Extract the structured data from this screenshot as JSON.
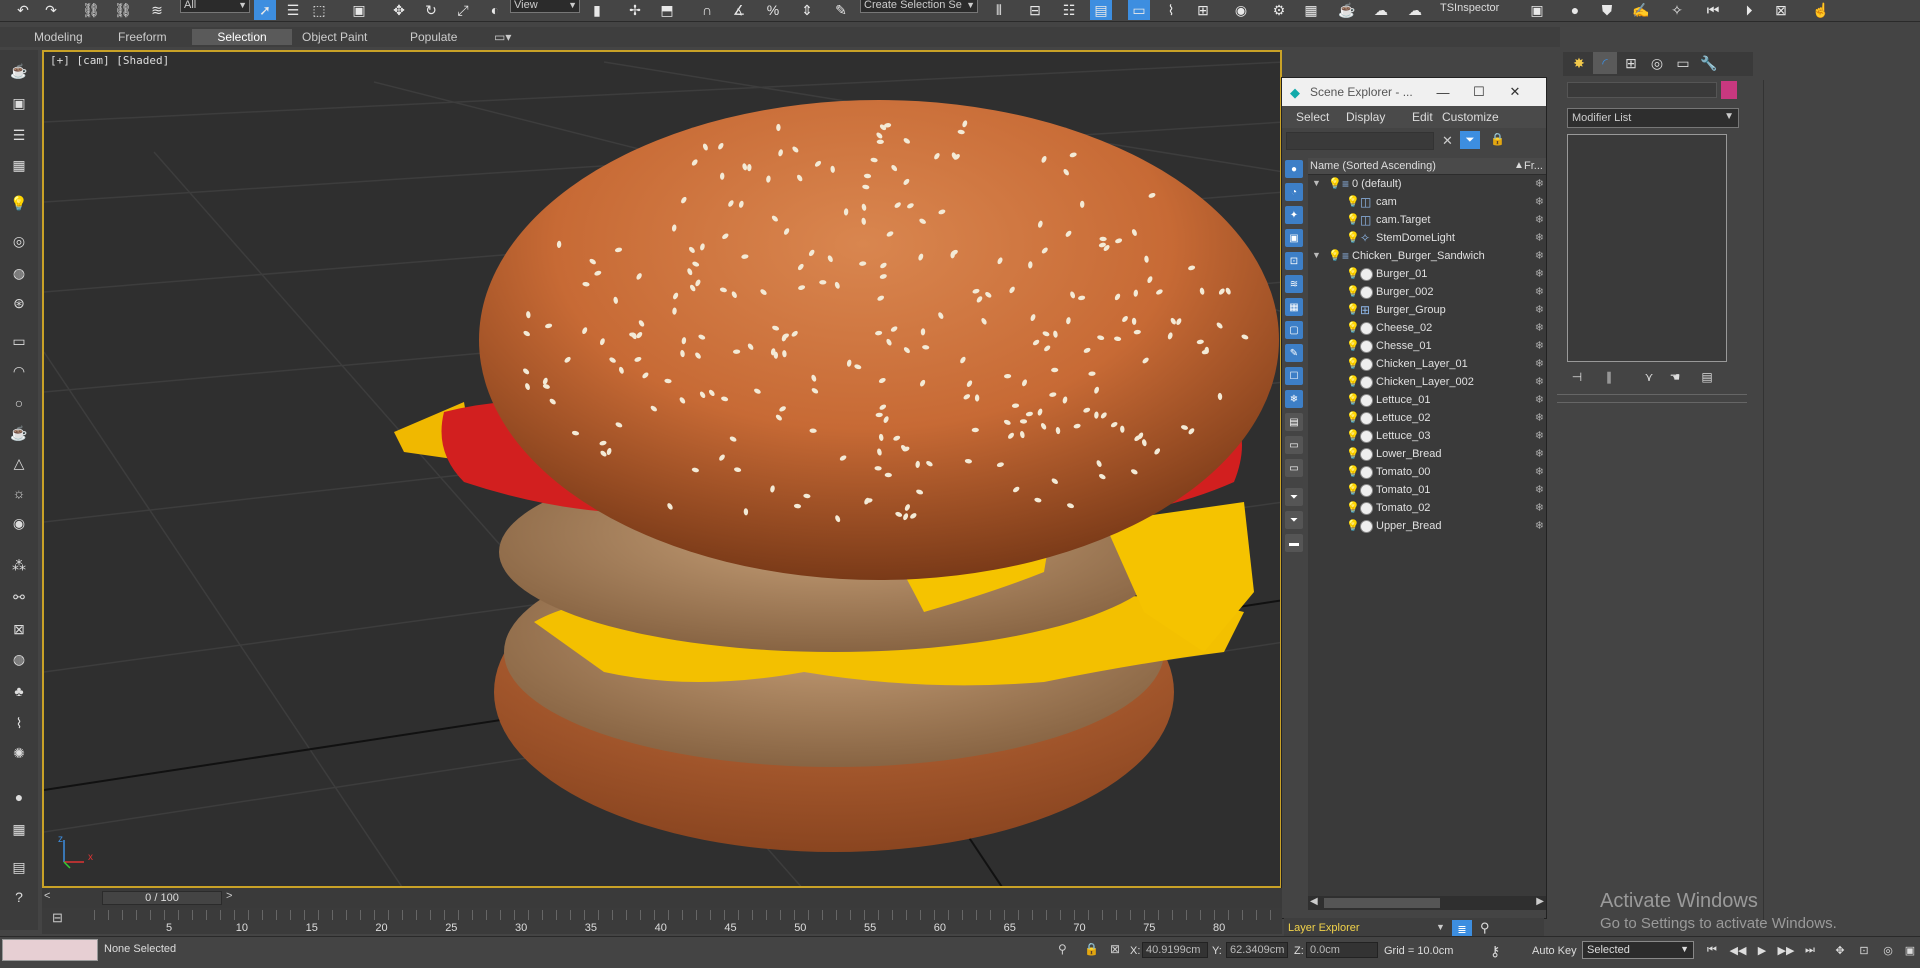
{
  "toolbar": {
    "filter_combo": "All",
    "refcoord_combo": "View",
    "selection_set_combo": "Create Selection Se",
    "plugin_label": "TSInspector"
  },
  "ribbon": {
    "tabs": [
      "Modeling",
      "Freeform",
      "Selection",
      "Object Paint",
      "Populate"
    ],
    "active_tab": "Selection"
  },
  "viewport": {
    "label": "[+] [cam] [Shaded]",
    "axis_x": "x",
    "axis_z": "z"
  },
  "scene_explorer": {
    "title": "Scene Explorer - ...",
    "menu": [
      "Select",
      "Display",
      "Edit",
      "Customize"
    ],
    "column_name": "Name (Sorted Ascending)",
    "column_frozen": "Fr...",
    "rows": [
      {
        "name": "0 (default)",
        "level": 0,
        "type": "layer"
      },
      {
        "name": "cam",
        "level": 1,
        "type": "camera"
      },
      {
        "name": "cam.Target",
        "level": 1,
        "type": "camera"
      },
      {
        "name": "StemDomeLight",
        "level": 1,
        "type": "light"
      },
      {
        "name": "Chicken_Burger_Sandwich",
        "level": 0,
        "type": "layer"
      },
      {
        "name": "Burger_01",
        "level": 1,
        "type": "geo"
      },
      {
        "name": "Burger_002",
        "level": 1,
        "type": "geo"
      },
      {
        "name": "Burger_Group",
        "level": 1,
        "type": "group"
      },
      {
        "name": "Cheese_02",
        "level": 1,
        "type": "geo"
      },
      {
        "name": "Chesse_01",
        "level": 1,
        "type": "geo"
      },
      {
        "name": "Chicken_Layer_01",
        "level": 1,
        "type": "geo"
      },
      {
        "name": "Chicken_Layer_002",
        "level": 1,
        "type": "geo"
      },
      {
        "name": "Lettuce_01",
        "level": 1,
        "type": "geo"
      },
      {
        "name": "Lettuce_02",
        "level": 1,
        "type": "geo"
      },
      {
        "name": "Lettuce_03",
        "level": 1,
        "type": "geo"
      },
      {
        "name": "Lower_Bread",
        "level": 1,
        "type": "geo"
      },
      {
        "name": "Tomato_00",
        "level": 1,
        "type": "geo"
      },
      {
        "name": "Tomato_01",
        "level": 1,
        "type": "geo"
      },
      {
        "name": "Tomato_02",
        "level": 1,
        "type": "geo"
      },
      {
        "name": "Upper_Bread",
        "level": 1,
        "type": "geo"
      }
    ],
    "layer_explorer_label": "Layer Explorer"
  },
  "command_panel": {
    "modifier_list": "Modifier List"
  },
  "activate_windows": {
    "line1": "Activate Windows",
    "line2": "Go to Settings to activate Windows."
  },
  "timeline": {
    "frame_display": "0 / 100",
    "ticks": [
      "5",
      "10",
      "15",
      "20",
      "25",
      "30",
      "35",
      "40",
      "45",
      "50",
      "55",
      "60",
      "65",
      "70",
      "75",
      "80"
    ]
  },
  "status": {
    "selection_text": "None Selected",
    "x_label": "X:",
    "x_value": "40.9199cm",
    "y_label": "Y:",
    "y_value": "62.3409cm",
    "z_label": "Z:",
    "z_value": "0.0cm",
    "grid": "Grid = 10.0cm",
    "auto_key": "Auto Key",
    "selected_combo": "Selected"
  },
  "colors": {
    "active_blue": "#3d8ee0",
    "viewport_border": "#c9a227",
    "object_color": "#c8387f"
  }
}
